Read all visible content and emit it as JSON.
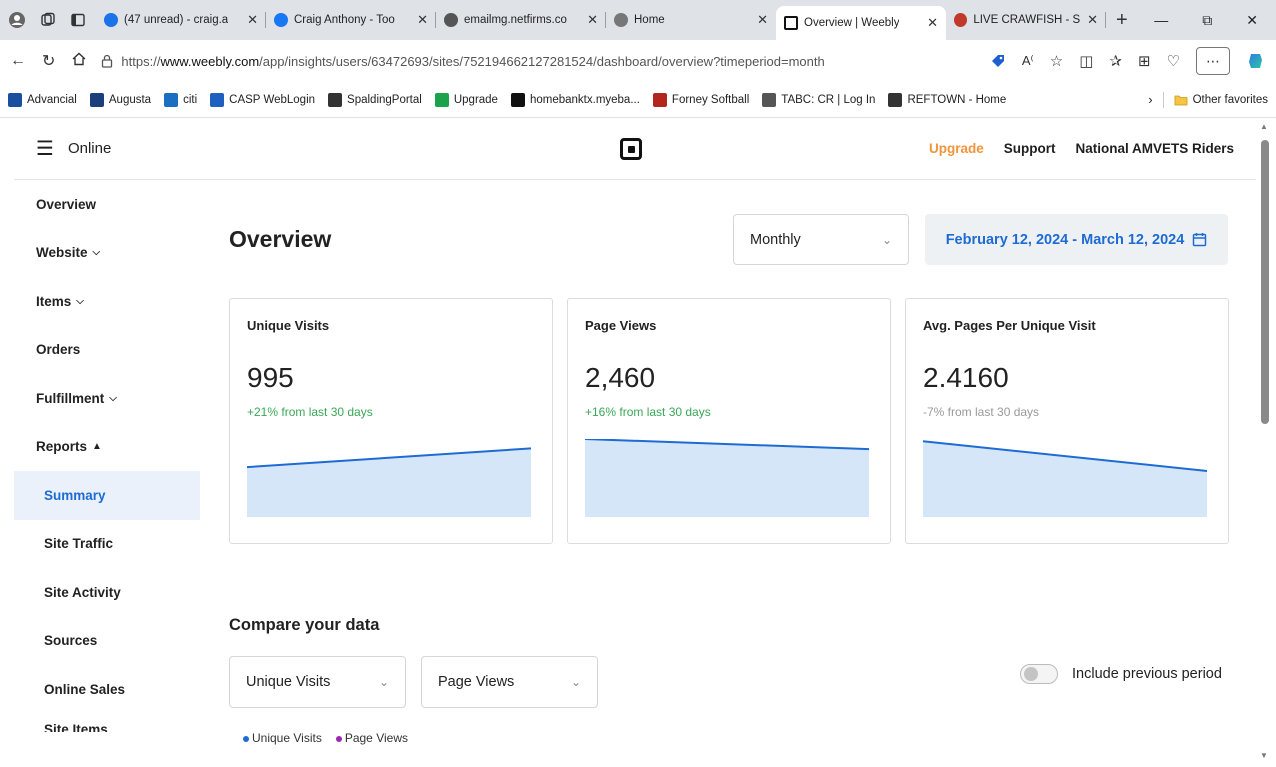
{
  "browser": {
    "tabs": [
      {
        "label": "(47 unread) - craig.a",
        "icon": "mail-icon",
        "color": "#1a73e8"
      },
      {
        "label": "Craig Anthony - Too",
        "icon": "facebook-icon",
        "color": "#1877f2"
      },
      {
        "label": "emailmg.netfirms.co",
        "icon": "document-icon",
        "color": "#555555"
      },
      {
        "label": "Home",
        "icon": "site-icon",
        "color": "#777777"
      },
      {
        "label": "Overview | Weebly",
        "icon": "square-logo-icon",
        "color": "#111111"
      },
      {
        "label": "LIVE CRAWFISH - Su",
        "icon": "crawfish-icon",
        "color": "#c0392b"
      }
    ],
    "address_prefix": "https://",
    "address_host": "www.weebly.com",
    "address_path": "/app/insights/users/63472693/sites/752194662127281524/dashboard/overview?timeperiod=month",
    "favorites": [
      {
        "label": "Advancial",
        "icon": "advancial-icon",
        "color": "#1a4fa0"
      },
      {
        "label": "Augusta",
        "icon": "augusta-icon",
        "color": "#1a3f7a"
      },
      {
        "label": "citi",
        "icon": "citi-icon",
        "color": "#1b6fc2"
      },
      {
        "label": "CASP WebLogin",
        "icon": "casp-icon",
        "color": "#1f5fbf"
      },
      {
        "label": "SpaldingPortal",
        "icon": "spalding-icon",
        "color": "#333333"
      },
      {
        "label": "Upgrade",
        "icon": "upgrade-icon",
        "color": "#1aa34a"
      },
      {
        "label": "homebanktx.myeba...",
        "icon": "hb-icon",
        "color": "#111111"
      },
      {
        "label": "Forney Softball",
        "icon": "forney-icon",
        "color": "#b3261e"
      },
      {
        "label": "TABC: CR | Log In",
        "icon": "document-icon",
        "color": "#555555"
      },
      {
        "label": "REFTOWN - Home",
        "icon": "reftown-icon",
        "color": "#333333"
      }
    ],
    "other_favorites": "Other favorites"
  },
  "topnav": {
    "brand": "Online",
    "upgrade": "Upgrade",
    "support": "Support",
    "account": "National AMVETS Riders"
  },
  "sidebar": {
    "items": [
      {
        "label": "Overview",
        "chevron": ""
      },
      {
        "label": "Website",
        "chevron": "down"
      },
      {
        "label": "Items",
        "chevron": "down"
      },
      {
        "label": "Orders",
        "chevron": ""
      },
      {
        "label": "Fulfillment",
        "chevron": "down"
      },
      {
        "label": "Reports",
        "chevron": "up"
      }
    ],
    "report_items": [
      "Summary",
      "Site Traffic",
      "Site Activity",
      "Sources",
      "Online Sales"
    ],
    "cutoff_item": "Site Items"
  },
  "main": {
    "title": "Overview",
    "period_select": "Monthly",
    "date_range": "February 12, 2024 - March 12, 2024",
    "cards": [
      {
        "label": "Unique Visits",
        "value": "995",
        "change": "+21% from last 30 days",
        "trend": "up",
        "spark": [
          0.36,
          0.12
        ]
      },
      {
        "label": "Page Views",
        "value": "2,460",
        "change": "+16% from last 30 days",
        "trend": "up",
        "spark": [
          0.0,
          0.13
        ]
      },
      {
        "label": "Avg. Pages Per Unique Visit",
        "value": "2.4160",
        "change": "-7% from last 30 days",
        "trend": "down",
        "spark": [
          0.03,
          0.41
        ]
      }
    ],
    "compare_title": "Compare your data",
    "compare_select_1": "Unique Visits",
    "compare_select_2": "Page Views",
    "toggle_label": "Include previous period",
    "legend": [
      {
        "label": "Unique Visits",
        "color": "#1d6bd3"
      },
      {
        "label": "Page Views",
        "color": "#9b27b0"
      }
    ]
  },
  "colors": {
    "accent": "#1d6bd3",
    "upgrade": "#f0953a",
    "positive": "#3aa757",
    "neutral": "#999999",
    "spark_fill": "#d6e6f9"
  }
}
